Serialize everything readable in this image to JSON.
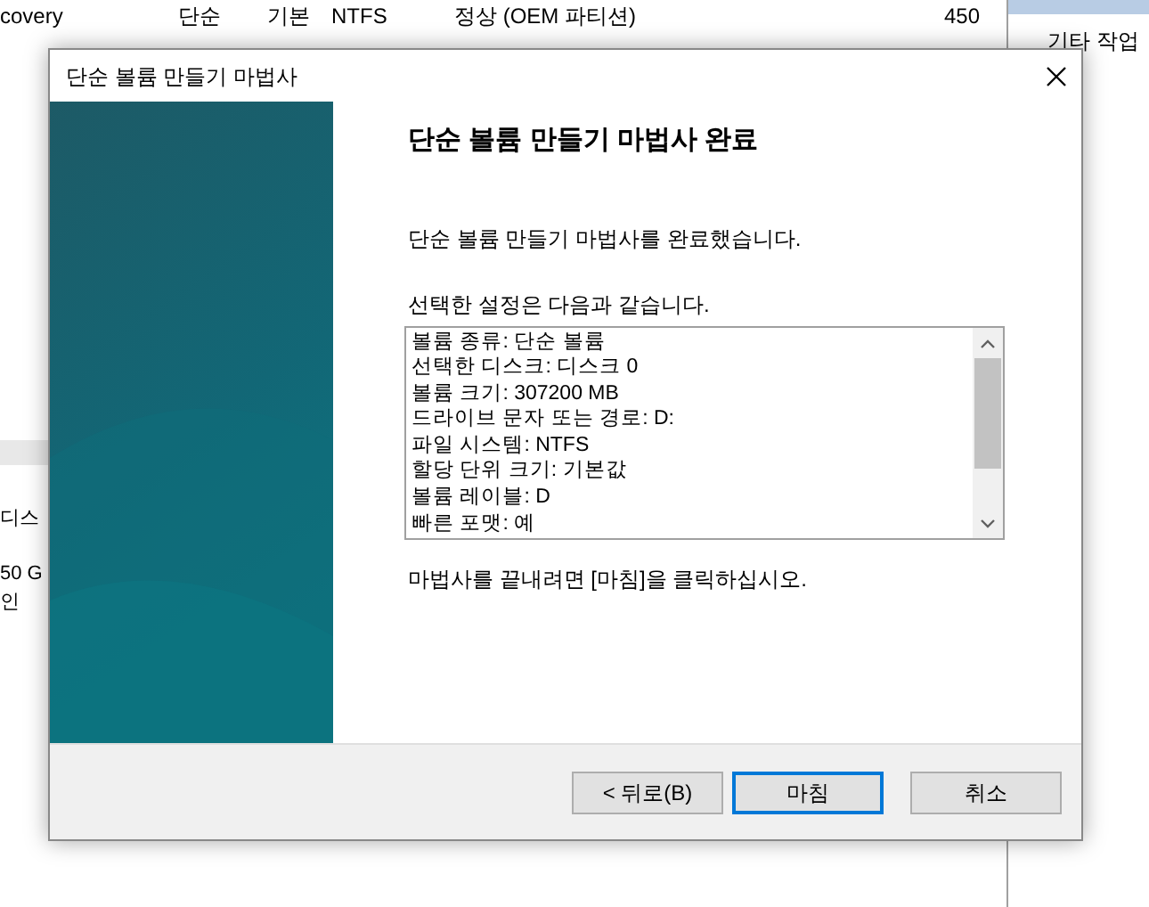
{
  "background": {
    "rows": [
      {
        "cells": [
          "covery",
          "단순",
          "기본",
          "NTFS",
          "정상 (OEM 파티션)",
          "450"
        ]
      }
    ],
    "disk_label": "디스",
    "disk_size": "50 G",
    "disk_status": "인",
    "actions_item": "기타 작업"
  },
  "dialog": {
    "title": "단순 볼륨 만들기 마법사",
    "heading": "단순 볼륨 만들기 마법사 완료",
    "intro": "단순 볼륨 만들기 마법사를 완료했습니다.",
    "settings_label": "선택한 설정은 다음과 같습니다.",
    "settings": [
      "볼륨 종류: 단순 볼륨",
      "선택한 디스크: 디스크 0",
      "볼륨 크기: 307200 MB",
      "드라이브 문자 또는 경로: D:",
      "파일 시스템: NTFS",
      "할당 단위 크기: 기본값",
      "볼륨 레이블: D",
      "빠른 포맷: 예"
    ],
    "finish_hint": "마법사를 끝내려면 [마침]을 클릭하십시오.",
    "buttons": [
      {
        "label": "< 뒤로(B)",
        "selected": false
      },
      {
        "label": "마침",
        "selected": true
      },
      {
        "label": "취소",
        "selected": false
      }
    ]
  }
}
